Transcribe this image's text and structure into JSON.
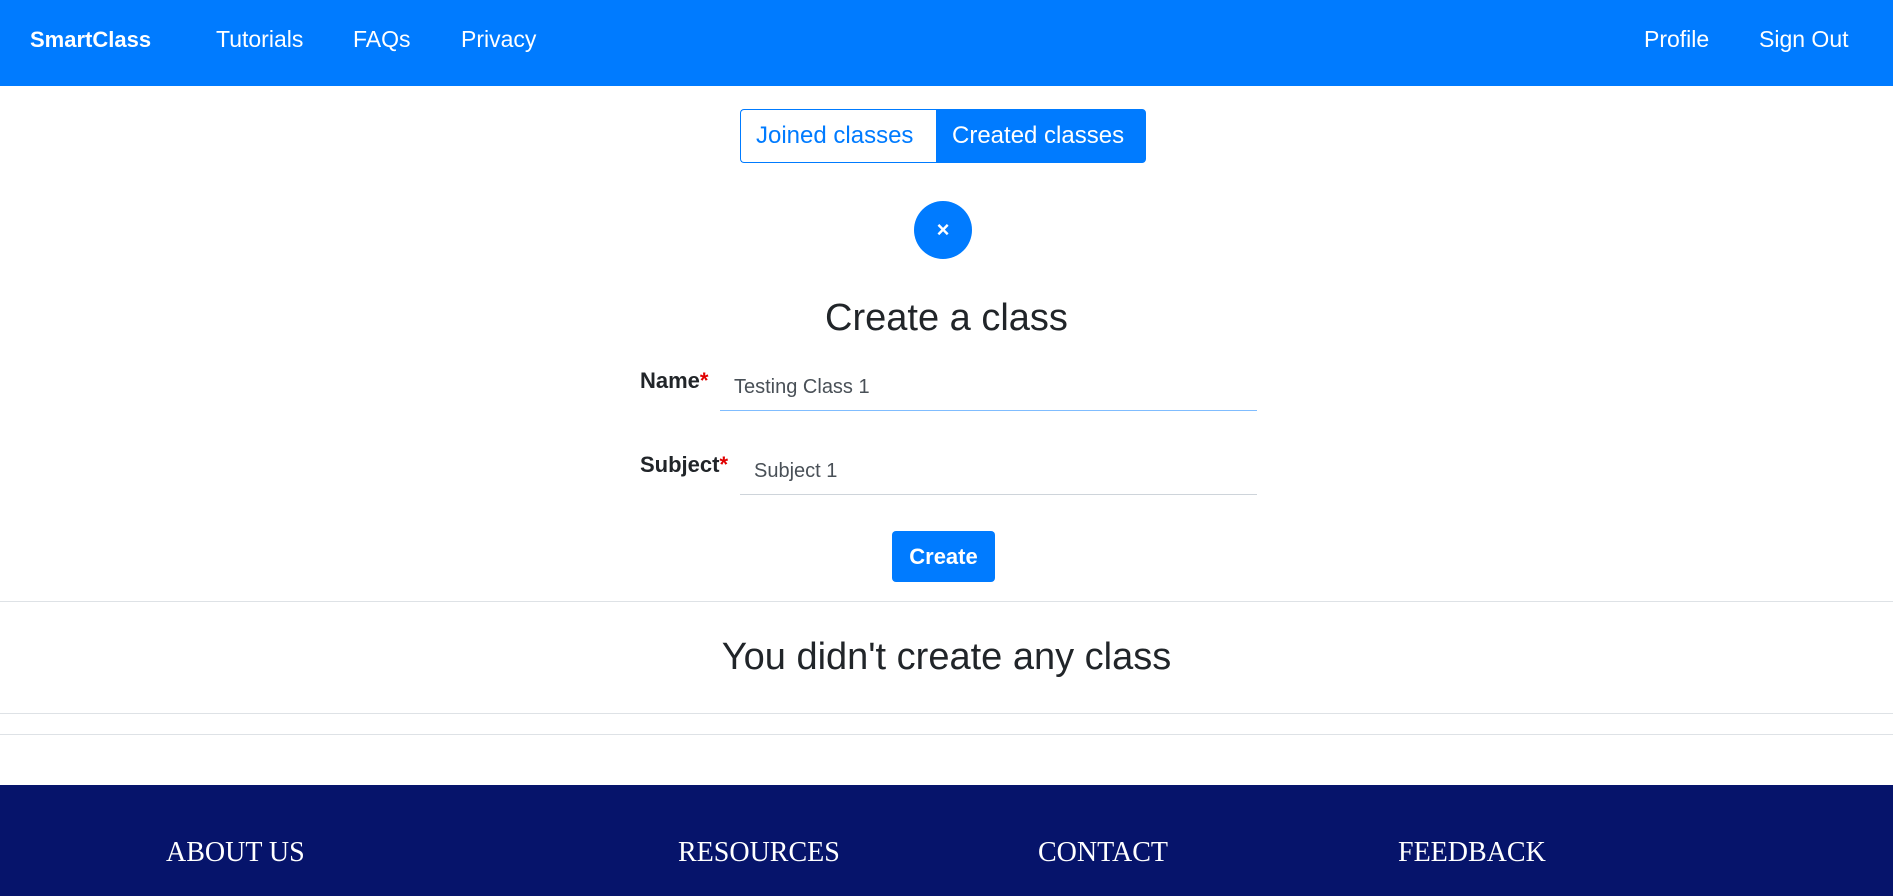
{
  "navbar": {
    "brand": "SmartClass",
    "links": [
      "Tutorials",
      "FAQs",
      "Privacy"
    ],
    "right_links": [
      "Profile",
      "Sign Out"
    ]
  },
  "toggle": {
    "joined_label": "Joined classes",
    "created_label": "Created classes",
    "active": "Created classes"
  },
  "close_icon": "×",
  "form": {
    "title": "Create a class",
    "name_label": "Name",
    "subject_label": "Subject",
    "required_mark": "*",
    "name_value": "Testing Class 1",
    "subject_value": "Subject 1",
    "submit_label": "Create"
  },
  "empty_state": "You didn't create any class",
  "footer": {
    "headings": [
      "ABOUT US",
      "RESOURCES",
      "CONTACT",
      "FEEDBACK"
    ]
  },
  "colors": {
    "primary": "#007bff",
    "footer_bg": "#06146b",
    "required": "#e00000"
  }
}
